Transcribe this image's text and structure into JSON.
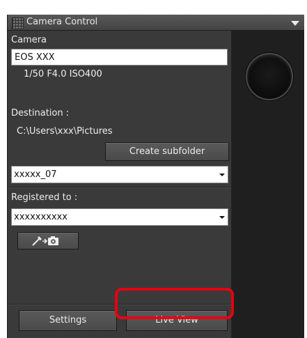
{
  "window": {
    "title": "Camera Control"
  },
  "camera": {
    "section_label": "Camera",
    "model": "EOS XXX",
    "exposure": "1/50  F4.0  ISO400"
  },
  "destination": {
    "label": "Destination :",
    "path": "C:\\Users\\xxx\\Pictures",
    "create_subfolder_label": "Create subfolder",
    "folder_value": "xxxxx_07"
  },
  "registered": {
    "label": "Registered to :",
    "value": "xxxxxxxxxx"
  },
  "buttons": {
    "settings_label": "Settings",
    "live_view_label": "Live View"
  },
  "colors": {
    "panel_bg": "#3a3a3a",
    "highlight": "#e60012"
  }
}
